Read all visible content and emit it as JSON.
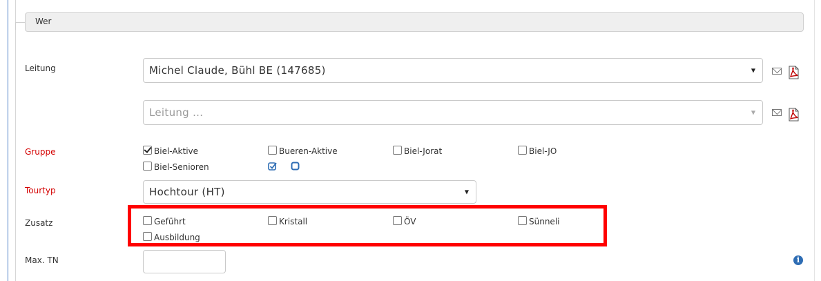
{
  "section": {
    "title": "Wer"
  },
  "leitung": {
    "label": "Leitung",
    "primary_value": "Michel Claude, Bühl BE (147685)",
    "secondary_placeholder": "Leitung ..."
  },
  "gruppe": {
    "label": "Gruppe",
    "options": [
      {
        "label": "Biel-Aktive",
        "checked": true
      },
      {
        "label": "Bueren-Aktive",
        "checked": false
      },
      {
        "label": "Biel-Jorat",
        "checked": false
      },
      {
        "label": "Biel-JO",
        "checked": false
      },
      {
        "label": "Biel-Senioren",
        "checked": false
      }
    ],
    "tools": [
      "check-all-icon",
      "uncheck-all-icon"
    ]
  },
  "tourtyp": {
    "label": "Tourtyp",
    "value": "Hochtour (HT)"
  },
  "zusatz": {
    "label": "Zusatz",
    "options": [
      {
        "label": "Geführt",
        "checked": false
      },
      {
        "label": "Kristall",
        "checked": false
      },
      {
        "label": "ÖV",
        "checked": false
      },
      {
        "label": "Sünneli",
        "checked": false
      },
      {
        "label": "Ausbildung",
        "checked": false
      }
    ]
  },
  "max_tn": {
    "label": "Max. TN",
    "value": ""
  },
  "colors": {
    "required_label": "#d40000",
    "highlight": "#ff0000",
    "accent": "#2e6db4"
  },
  "icons": {
    "mail": "mail-icon",
    "pdf": "pdf-icon",
    "info": "info-icon"
  }
}
